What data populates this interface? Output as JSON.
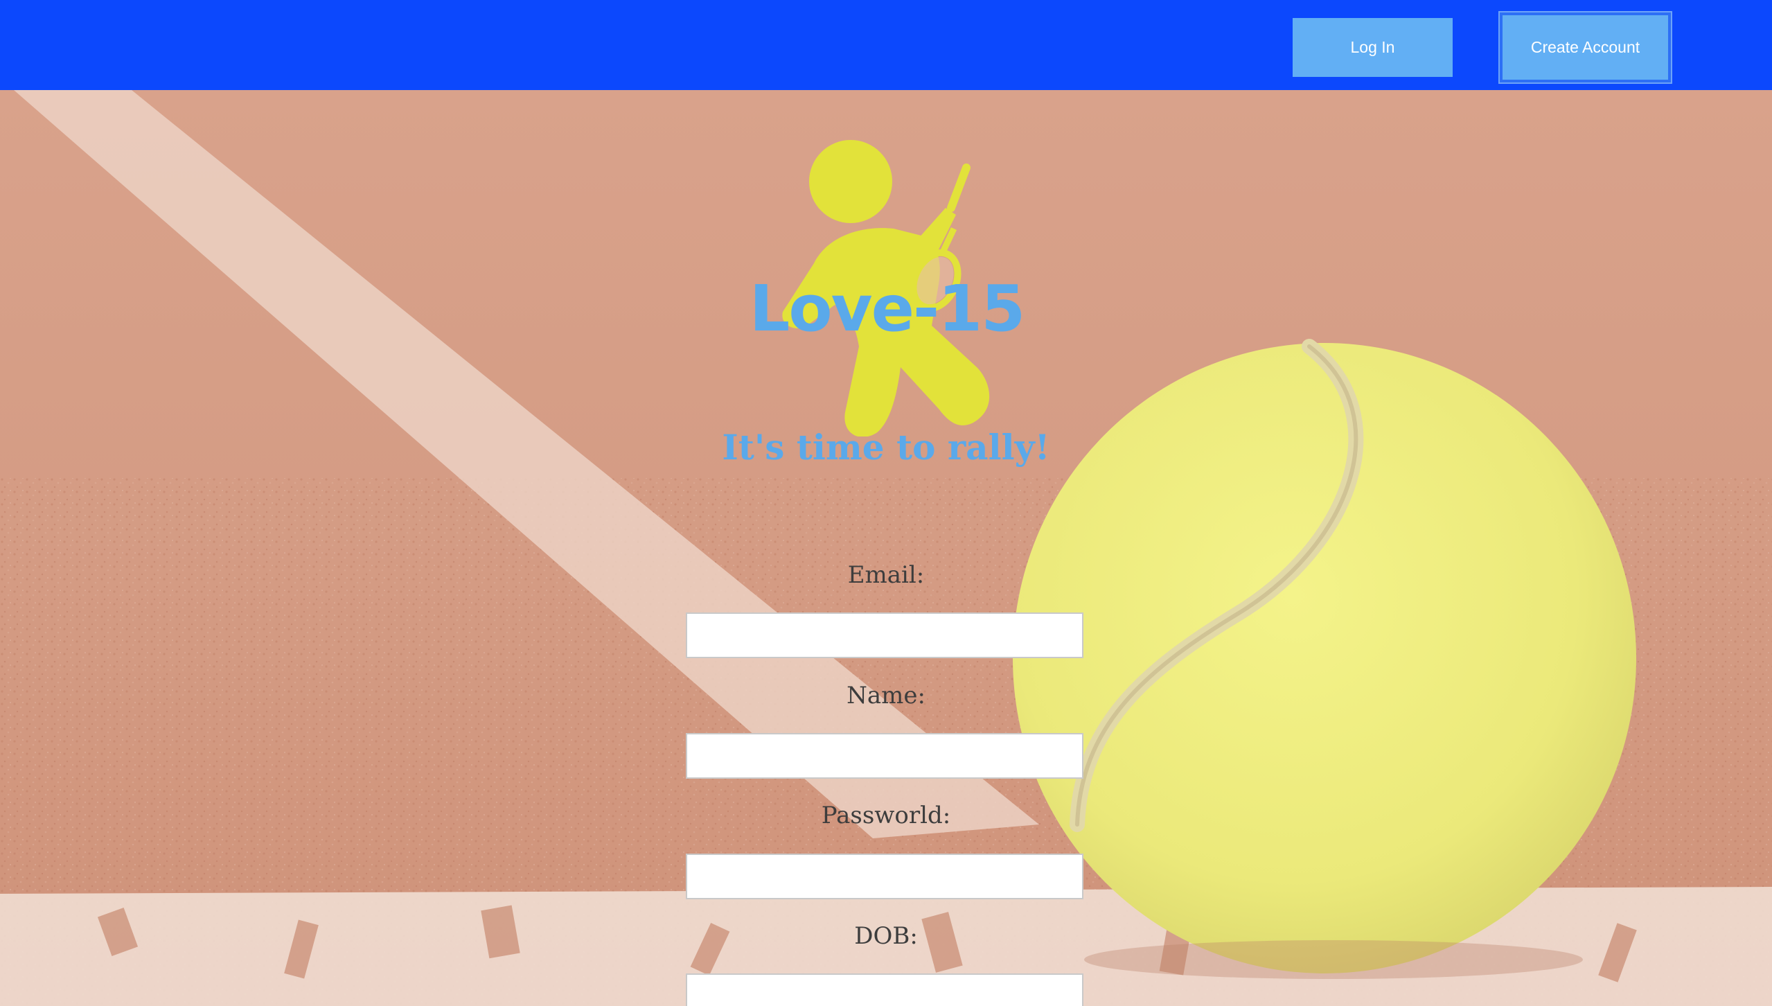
{
  "header": {
    "login_label": "Log In",
    "create_account_label": "Create Account",
    "background_color": "#0c48fd",
    "button_color": "#62aff4"
  },
  "brand": {
    "name": "Love-15",
    "tagline": "It's time to rally!",
    "brand_color": "#5aa9ea",
    "logo_color": "#e2e23a"
  },
  "form": {
    "fields": [
      {
        "label": "Email:",
        "value": "",
        "placeholder": ""
      },
      {
        "label": "Name:",
        "value": "",
        "placeholder": ""
      },
      {
        "label": "Passworld:",
        "value": "",
        "placeholder": ""
      },
      {
        "label": "DOB:",
        "value": "",
        "placeholder": ""
      }
    ]
  },
  "background": {
    "subject": "tennis-ball-on-clay-court",
    "court_color": "#d7a089",
    "ball_color": "#eef07a"
  }
}
